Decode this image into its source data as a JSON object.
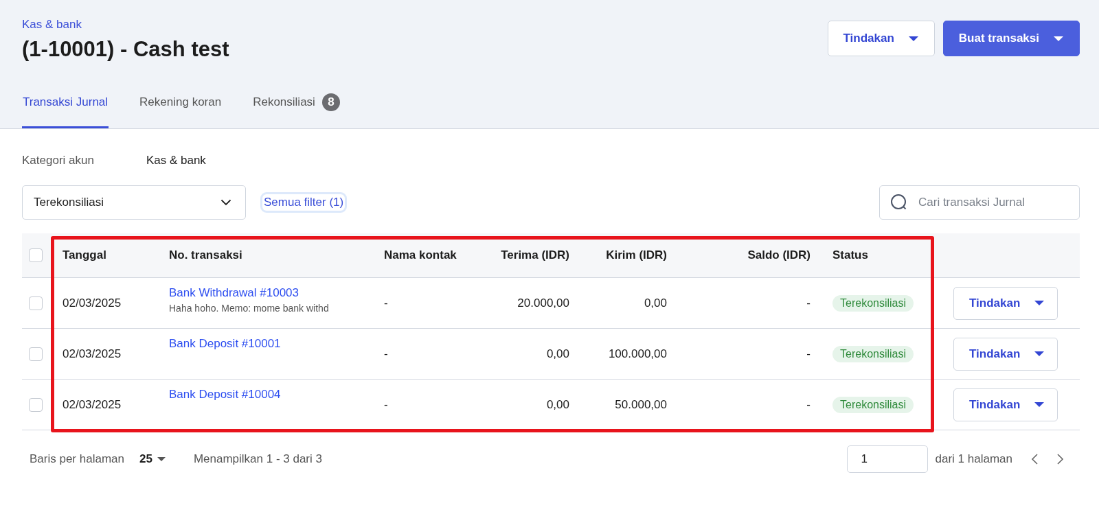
{
  "breadcrumb": "Kas & bank",
  "title": "(1-10001) - Cash test",
  "header_buttons": [
    {
      "label": "Tindakan",
      "kind": "secondary"
    },
    {
      "label": "Buat transaksi",
      "kind": "primary"
    }
  ],
  "tabs": [
    {
      "label": "Transaksi Jurnal",
      "selected": true
    },
    {
      "label": "Rekening koran",
      "selected": false
    },
    {
      "label": "Rekonsiliasi",
      "selected": false,
      "badge": "8"
    }
  ],
  "account_category": {
    "label": "Kategori akun",
    "value": "Kas & bank"
  },
  "status_filter": {
    "value": "Terekonsiliasi"
  },
  "all_filters_link": "Semua filter (1)",
  "search": {
    "placeholder": "Cari transaksi Jurnal"
  },
  "table": {
    "select_all_checked": false,
    "columns": [
      "Tanggal",
      "No. transaksi",
      "Nama kontak",
      "Terima (IDR)",
      "Kirim (IDR)",
      "Saldo (IDR)",
      "Status"
    ],
    "rows": [
      {
        "checked": false,
        "date": "02/03/2025",
        "transaction": "Bank Withdrawal #10003",
        "memo": "Haha hoho. Memo: mome bank withd",
        "contact": "-",
        "received": "20.000,00",
        "sent": "0,00",
        "balance": "-",
        "status": "Terekonsiliasi",
        "action": "Tindakan"
      },
      {
        "checked": false,
        "date": "02/03/2025",
        "transaction": "Bank Deposit #10001",
        "contact": "-",
        "received": "0,00",
        "sent": "100.000,00",
        "balance": "-",
        "status": "Terekonsiliasi",
        "action": "Tindakan"
      },
      {
        "checked": false,
        "date": "02/03/2025",
        "transaction": "Bank Deposit #10004",
        "contact": "-",
        "received": "0,00",
        "sent": "50.000,00",
        "balance": "-",
        "status": "Terekonsiliasi",
        "action": "Tindakan"
      }
    ]
  },
  "pagination": {
    "rows_label": "Baris per halaman",
    "rows_per_page": "25",
    "summary": "Menampilkan 1 - 3 dari 3",
    "page": "1",
    "page_total": "dari 1 halaman"
  }
}
